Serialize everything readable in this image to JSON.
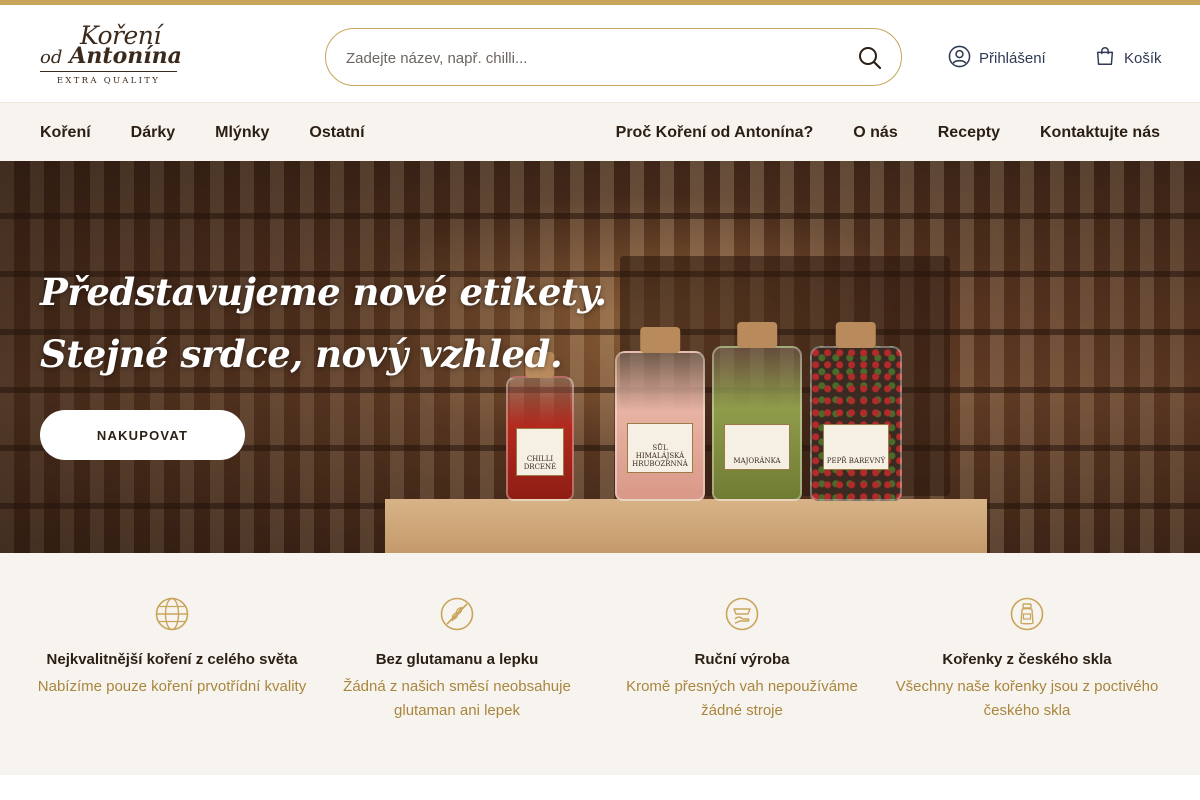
{
  "colors": {
    "accent": "#c9a55c",
    "gold_text": "#a9863f",
    "dark_text": "#2b1f14",
    "nav_bg": "#f7f4ef"
  },
  "logo": {
    "line1": "Koření",
    "line2_od": "od",
    "line2_name": "Antonína",
    "tagline": "EXTRA QUALITY"
  },
  "search": {
    "placeholder": "Zadejte název, např. chilli...",
    "icon": "search-icon"
  },
  "header": {
    "login_label": "Přihlášení",
    "login_icon": "user-icon",
    "cart_label": "Košík",
    "cart_icon": "shopping-bag-icon"
  },
  "nav": {
    "left": [
      "Koření",
      "Dárky",
      "Mlýnky",
      "Ostatní"
    ],
    "right": [
      "Proč Koření od Antonína?",
      "O nás",
      "Recepty",
      "Kontaktujte nás"
    ]
  },
  "hero": {
    "title_line1": "Představujeme nové etikety.",
    "title_line2": "Stejné srdce, nový vzhled.",
    "button": "NAKUPOVAT",
    "jar_labels": [
      "CHILLI DRCENÉ",
      "SŮL HIMALÁJSKÁ HRUBOZRNNÁ",
      "MAJORÁNKA",
      "PEPŘ BAREVNÝ"
    ]
  },
  "features": [
    {
      "icon": "globe-icon",
      "title": "Nejkvalitnější koření z celého světa",
      "desc": "Nabízíme pouze koření prvotřídní kvality"
    },
    {
      "icon": "no-wheat-icon",
      "title": "Bez glutamanu a lepku",
      "desc": "Žádná z našich směsí neobsahuje glutaman ani lepek"
    },
    {
      "icon": "hand-scale-icon",
      "title": "Ruční výroba",
      "desc": "Kromě přesných vah nepoužíváme žádné stroje"
    },
    {
      "icon": "jar-icon",
      "title": "Kořenky z českého skla",
      "desc": "Všechny naše kořenky jsou z poctivého českého skla"
    }
  ]
}
